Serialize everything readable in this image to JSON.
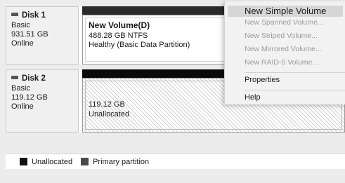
{
  "disks": [
    {
      "name": "Disk 1",
      "type": "Basic",
      "size": "931.51 GB",
      "status": "Online",
      "volume": {
        "title": "New Volume(D)",
        "detail": "488.28 GB NTFS",
        "status": "Healthy (Basic Data Partition)"
      }
    },
    {
      "name": "Disk 2",
      "type": "Basic",
      "size": "119.12 GB",
      "status": "Online",
      "volume": {
        "size": "119.12 GB",
        "status": "Unallocated"
      }
    }
  ],
  "legend": {
    "unallocated": "Unallocated",
    "primary": "Primary partition"
  },
  "context_menu": {
    "new_simple_volume": "New Simple Volume",
    "new_spanned_volume": "New Spanned Volume...",
    "new_striped_volume": "New Striped Volume...",
    "new_mirrored_volume": "New Mirrored Volume...",
    "new_raid5_volume": "New RAID-5 Volume...",
    "properties": "Properties",
    "help": "Help"
  },
  "colors": {
    "unallocated_swatch": "#111111",
    "primary_swatch": "#4a4a4a",
    "menu_highlight": "#d6d6d6"
  }
}
